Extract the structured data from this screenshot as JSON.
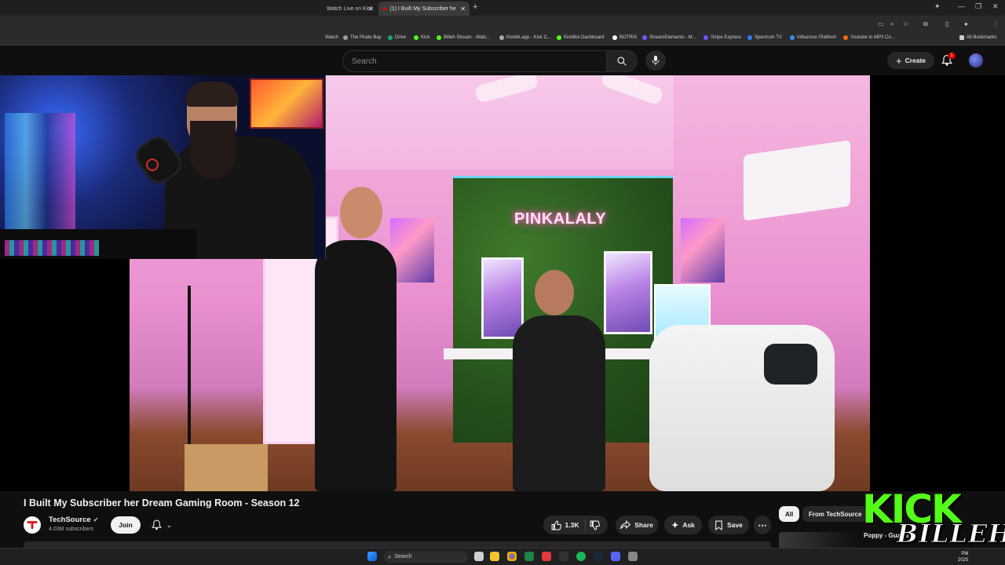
{
  "browser": {
    "tabs": [
      {
        "label": "Watch Live on Kick",
        "active": false
      },
      {
        "label": "(1) I Built My Subscriber he",
        "active": true
      }
    ],
    "bookmarks": [
      {
        "label": "Watch",
        "color": "#888888"
      },
      {
        "label": "The Pirate Bay",
        "color": "#9e9e9e"
      },
      {
        "label": "Drive",
        "color": "#1fa463"
      },
      {
        "label": "Kick",
        "color": "#53fc18"
      },
      {
        "label": "Billeh Stream - Watc...",
        "color": "#53fc18"
      },
      {
        "label": "Kicklet.app - Kick C...",
        "color": "#aaaaaa"
      },
      {
        "label": "KickBot Dashboard",
        "color": "#53fc18"
      },
      {
        "label": "BOTRIX",
        "color": "#ffffff"
      },
      {
        "label": "StreamElements - M...",
        "color": "#6a5cff"
      },
      {
        "label": "Stripe Express",
        "color": "#635bff"
      },
      {
        "label": "Spectrum TV",
        "color": "#2b7bff"
      },
      {
        "label": "Influencer Platform",
        "color": "#3a8bff"
      },
      {
        "label": "Youtube to MP3 Co...",
        "color": "#ff6a00"
      },
      {
        "label": "All Bookmarks",
        "color": "#cccccc"
      }
    ]
  },
  "youtube": {
    "search_placeholder": "Search",
    "create_label": "Create",
    "notification_count": "1"
  },
  "overlay_sign": "PINKALALY",
  "video": {
    "title": "I Built My Subscriber her Dream Gaming Room - Season 12",
    "channel": "TechSource",
    "subscribers": "4.03M subscribers",
    "join_label": "Join",
    "likes": "1.3K",
    "share_label": "Share",
    "ask_label": "Ask",
    "save_label": "Save"
  },
  "sidebar": {
    "chips": [
      "All",
      "From TechSource"
    ],
    "next_title": "Poppy - Guardi"
  },
  "kick_overlay": {
    "logo": "KICK",
    "handle": "BILLEH"
  },
  "taskbar": {
    "search_label": "Search",
    "clock_time": "PM",
    "clock_date": "2025"
  },
  "colors": {
    "yt_bg": "#0f0f0f",
    "kick_green": "#53fc18",
    "notify_red": "#cc0000"
  }
}
